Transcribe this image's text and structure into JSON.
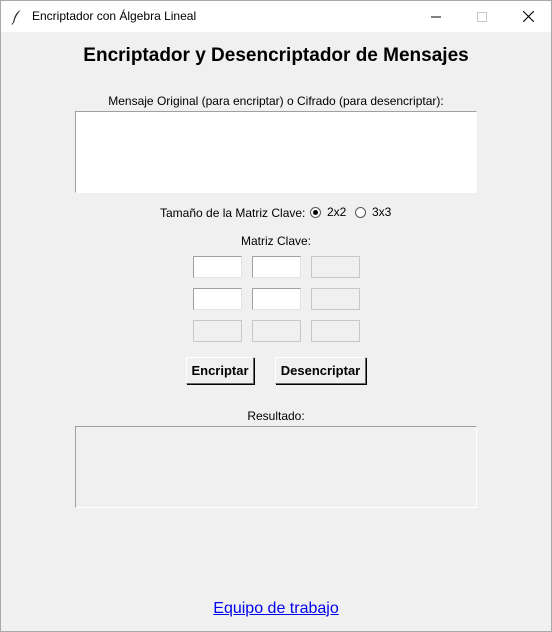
{
  "window": {
    "title": "Encriptador con Álgebra Lineal",
    "minimize_icon": "minimize-icon",
    "maximize_icon": "maximize-icon",
    "close_icon": "close-icon",
    "app_icon": "feather-icon"
  },
  "main": {
    "heading": "Encriptador y Desencriptador de Mensajes",
    "input_label": "Mensaje Original (para encriptar) o Cifrado (para desencriptar):",
    "input_value": "",
    "matrix_size_label": "Tamaño de la Matriz Clave:",
    "matrix_size_options": [
      {
        "label": "2x2",
        "checked": true
      },
      {
        "label": "3x3",
        "checked": false
      }
    ],
    "matrix_label": "Matriz Clave:",
    "matrix_cells": [
      [
        "",
        "",
        ""
      ],
      [
        "",
        "",
        ""
      ],
      [
        "",
        "",
        ""
      ]
    ],
    "encrypt_button": "Encriptar",
    "decrypt_button": "Desencriptar",
    "result_label": "Resultado:",
    "result_value": "",
    "team_link": "Equipo de trabajo"
  },
  "colors": {
    "link": "#0000ee",
    "background": "#f0f0f0"
  }
}
